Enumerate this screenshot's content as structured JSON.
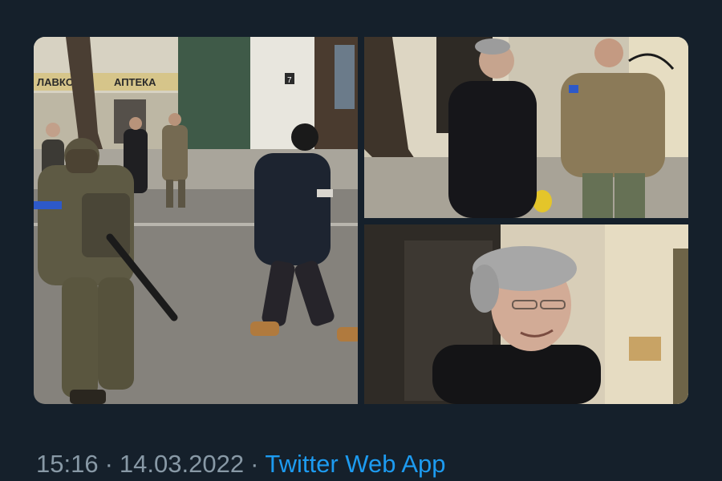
{
  "tweet": {
    "photos": [
      {
        "alt": "",
        "sign_left": "ЛАВКОЄ",
        "sign_right": "АПТЕКА",
        "door_number": "7"
      },
      {
        "alt": ""
      },
      {
        "alt": ""
      }
    ],
    "meta": {
      "time": "15:16",
      "separator": "·",
      "date": "14.03.2022",
      "source": "Twitter Web App"
    }
  },
  "colors": {
    "background": "#15202b",
    "meta_text": "#8899a6",
    "link": "#1d9bf0"
  }
}
